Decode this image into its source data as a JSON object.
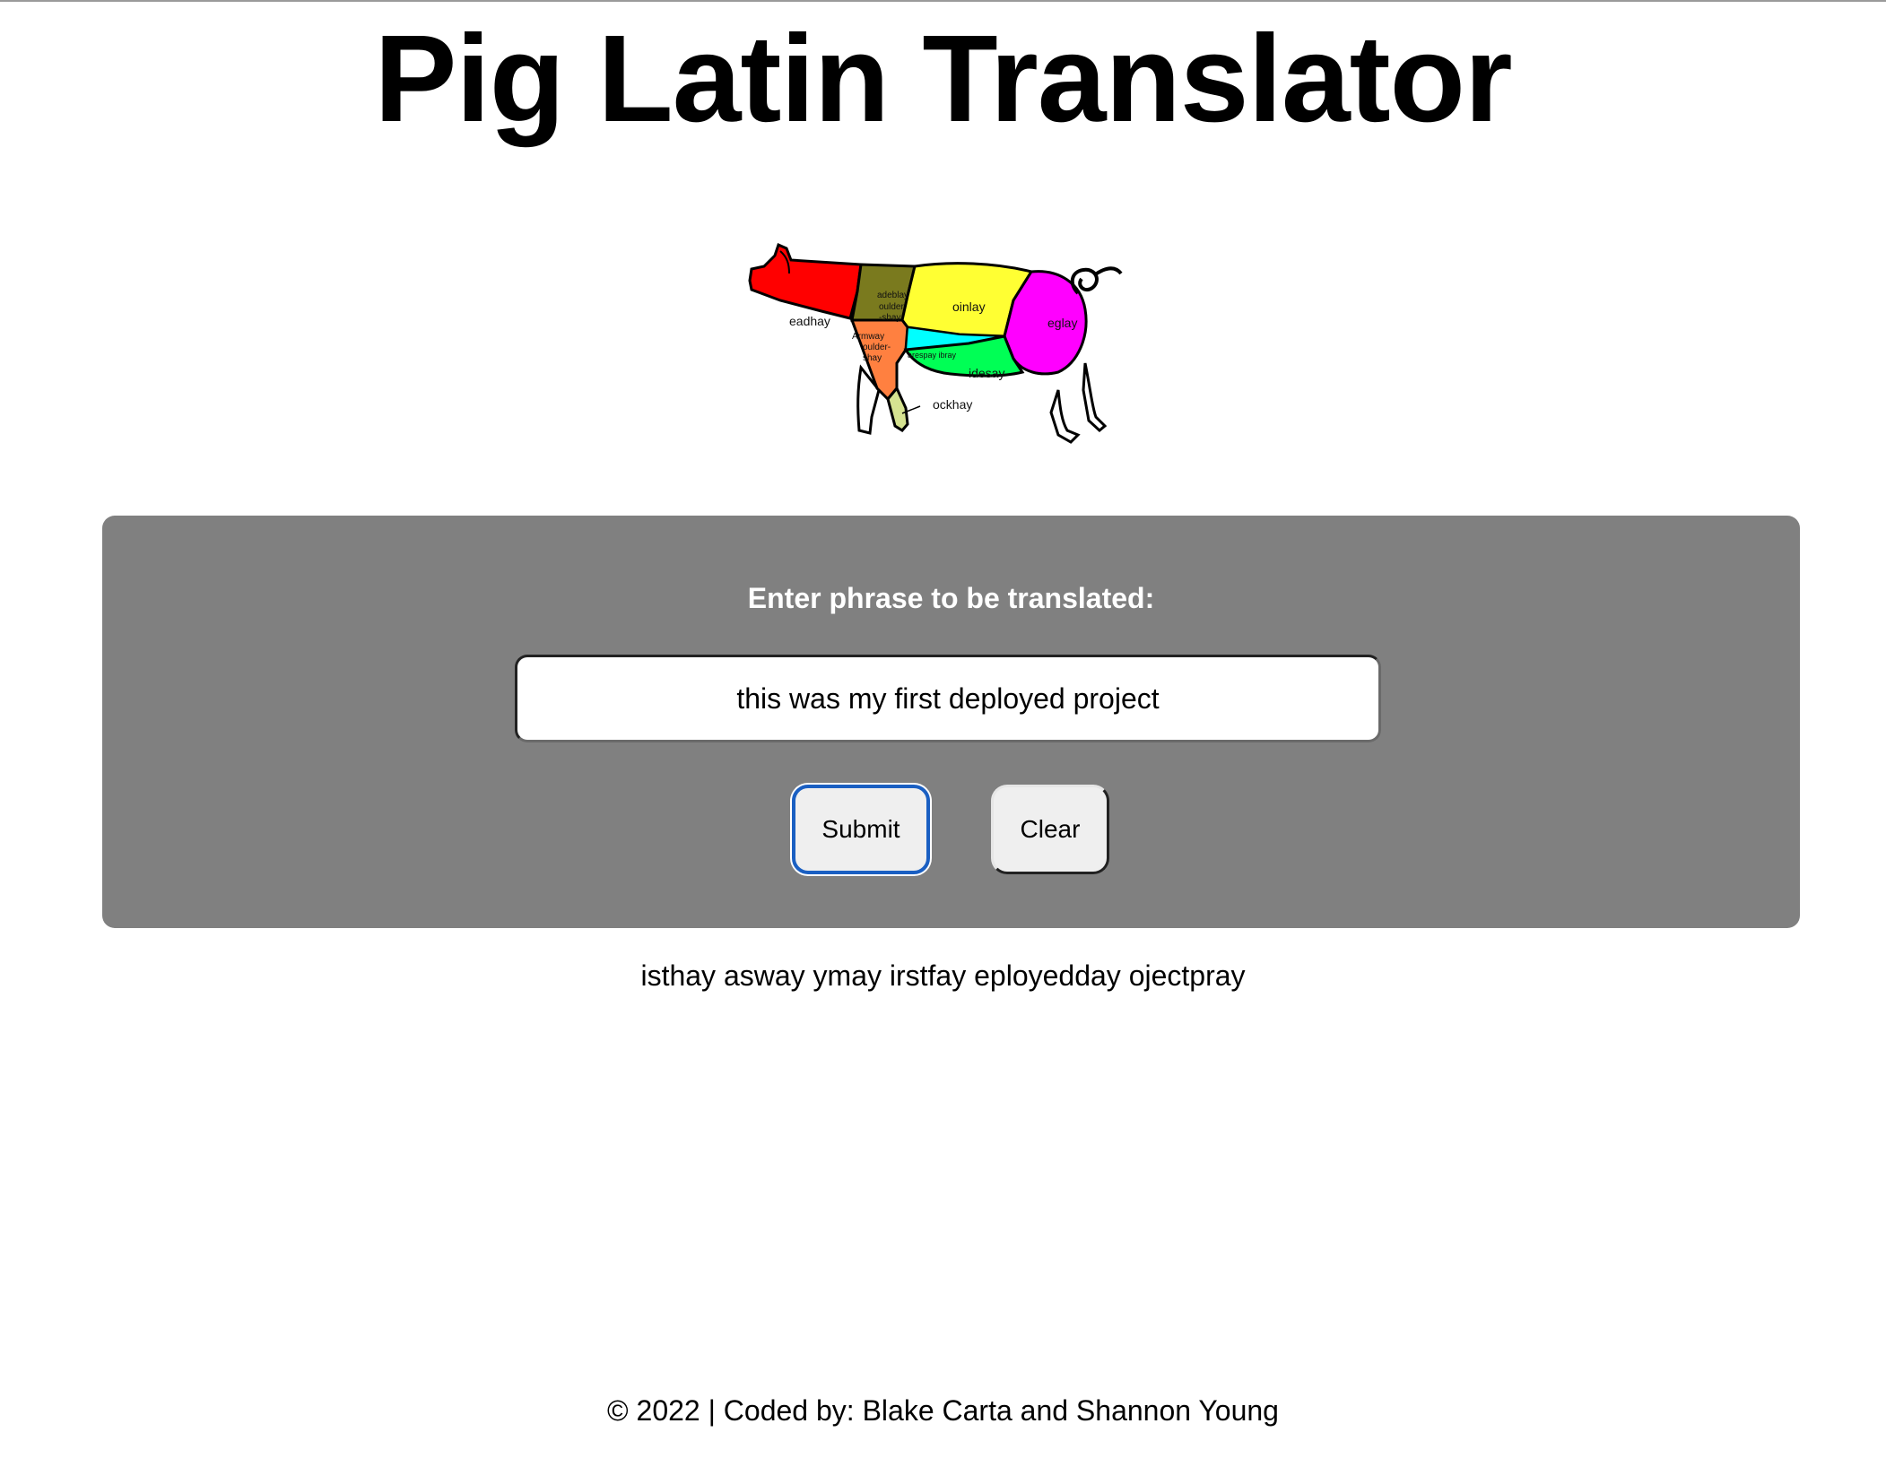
{
  "header": {
    "title": "Pig Latin Translator"
  },
  "pig_image": {
    "labels": {
      "head": "eadhay",
      "blade": "adeblay",
      "blade2": "oulder",
      "blade3": "-shay",
      "loin": "oinlay",
      "leg": "eglay",
      "arm": "Armway",
      "arm2": "oulder-",
      "arm3": "shay",
      "ribs": "arespay ibray",
      "side": "idesay",
      "hock": "ockhay"
    },
    "colors": {
      "head": "#ff0000",
      "blade": "#7a7a1e",
      "loin": "#ffff33",
      "leg": "#ff00ff",
      "arm": "#ff8040",
      "ribs": "#00ffff",
      "side": "#00ff55",
      "hock": "#d6e391"
    }
  },
  "form": {
    "prompt": "Enter phrase to be translated:",
    "input_value": "this was my first deployed project",
    "submit_label": "Submit",
    "clear_label": "Clear",
    "panel_color": "#808080",
    "focus_color": "#1a5fc2"
  },
  "result": {
    "text": "isthay asway ymay irstfay eployedday ojectpray"
  },
  "footer": {
    "text": "© 2022 | Coded by: Blake Carta and Shannon Young"
  }
}
